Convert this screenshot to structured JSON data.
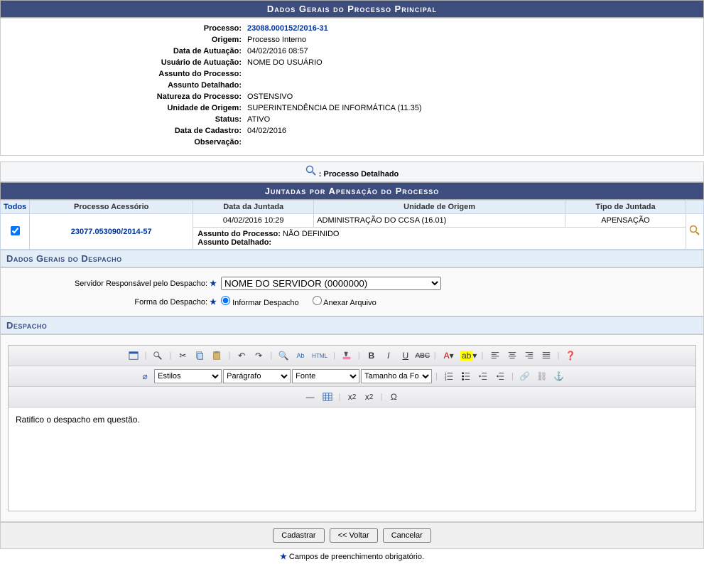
{
  "panel1_title": "Dados Gerais do Processo Principal",
  "fields": {
    "processo_l": "Processo:",
    "processo_v": "23088.000152/2016-31",
    "origem_l": "Origem:",
    "origem_v": "Processo Interno",
    "dataaut_l": "Data de Autuação:",
    "dataaut_v": "04/02/2016 08:57",
    "usuaut_l": "Usuário de Autuação:",
    "usuaut_v": "NOME DO USUÁRIO",
    "assunto_l": "Assunto do Processo:",
    "assunto_v": "",
    "assdet_l": "Assunto Detalhado:",
    "assdet_v": "",
    "natureza_l": "Natureza do Processo:",
    "natureza_v": "OSTENSIVO",
    "unidorig_l": "Unidade de Origem:",
    "unidorig_v": "SUPERINTENDÊNCIA DE INFORMÁTICA (11.35)",
    "status_l": "Status:",
    "status_v": "ATIVO",
    "datacad_l": "Data de Cadastro:",
    "datacad_v": "04/02/2016",
    "obs_l": "Observação:",
    "obs_v": ""
  },
  "detail_label": ": Processo Detalhado",
  "panel2_title": "Juntadas por Apensação do Processo",
  "table": {
    "h_todos": "Todos",
    "h_proc": "Processo Acessório",
    "h_data": "Data da Juntada",
    "h_unid": "Unidade de Origem",
    "h_tipo": "Tipo de Juntada",
    "r_proc": "23077.053090/2014-57",
    "r_data": "04/02/2016 10:29",
    "r_unid": "ADMINISTRAÇÃO DO CCSA (16.01)",
    "r_tipo": "APENSAÇÃO",
    "r_ass_l": "Assunto do Processo:",
    "r_ass_v": "NÃO DEFINIDO",
    "r_assd_l": "Assunto Detalhado:"
  },
  "despacho": {
    "section_title": "Dados Gerais do Despacho",
    "servidor_l": "Servidor Responsável pelo Despacho:",
    "servidor_v": "NOME DO SERVIDOR (0000000)",
    "forma_l": "Forma do Despacho:",
    "opt_informar": "Informar Despacho",
    "opt_anexar": "Anexar Arquivo",
    "editor_title": "Despacho",
    "sel_estilos": "Estilos",
    "sel_paragrafo": "Parágrafo",
    "sel_fonte": "Fonte",
    "sel_tamanho": "Tamanho da Fo",
    "html_label": "HTML",
    "content": "Ratifico o despacho em questão."
  },
  "buttons": {
    "cadastrar": "Cadastrar",
    "voltar": "<< Voltar",
    "cancelar": "Cancelar"
  },
  "footer": "Campos de preenchimento obrigatório."
}
